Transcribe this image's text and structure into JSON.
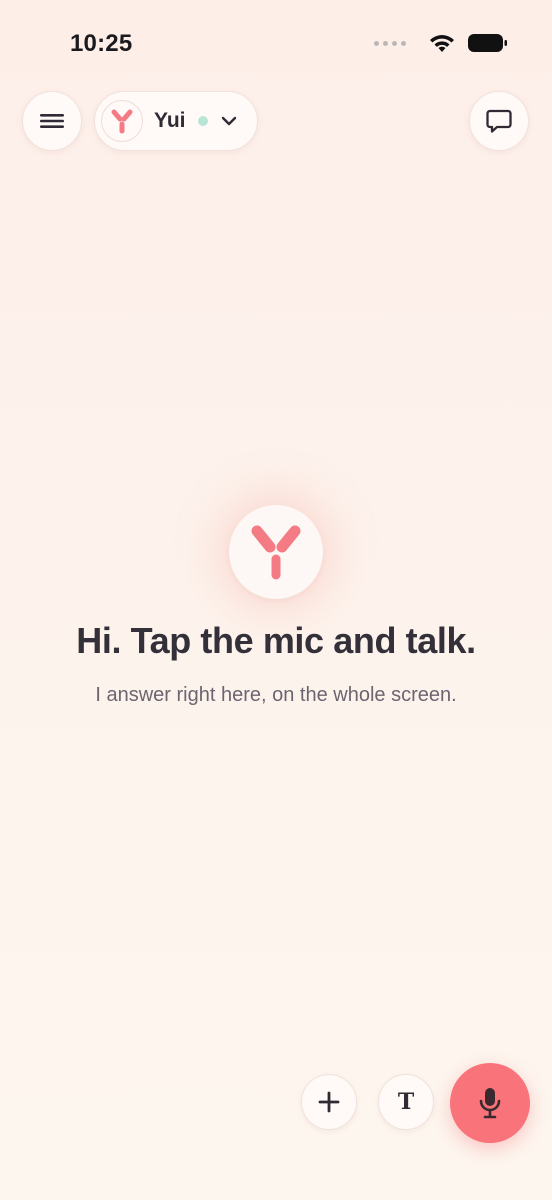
{
  "status_bar": {
    "time": "10:25"
  },
  "header": {
    "menu_icon": "hamburger-menu-icon",
    "assistant_name": "Yui",
    "assistant_status_color": "#b9e4d6",
    "dropdown_icon": "chevron-down-icon",
    "chat_icon": "chat-bubble-icon"
  },
  "main": {
    "logo_icon": "yui-logo-icon",
    "headline": "Hi. Tap the mic and talk.",
    "subline": "I answer right here, on the whole screen."
  },
  "bottom_bar": {
    "add_icon": "plus-icon",
    "text_mode_label": "T",
    "mic_icon": "microphone-icon"
  },
  "colors": {
    "accent": "#f9737a",
    "logo": "#f47b84",
    "text_primary": "#34303a",
    "text_secondary": "#6c6570"
  }
}
